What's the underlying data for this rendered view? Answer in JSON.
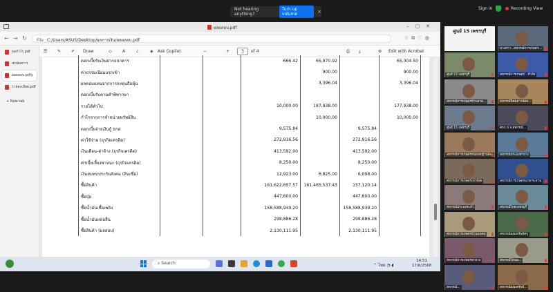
{
  "zoom": {
    "notice_text": "Not hearing anything?",
    "notice_button": "Turn up volume",
    "sign_in": "Sign in",
    "recording": "Recording",
    "view": "View"
  },
  "browser": {
    "window_title": "ผลผลอบ.pdf",
    "url_prefix": "File",
    "url": "C:/Users/ASUS/Desktop/ผลการเงิน/ผลผลอบ.pdf",
    "tabs": [
      {
        "label": "ผลกำไร.pdf"
      },
      {
        "label": "สรุปผลการเงิน.pdf"
      },
      {
        "label": "ผลผลอบ.pdf"
      },
      {
        "label": "รายละเอียด.pdf"
      }
    ],
    "new_tab": "New tab"
  },
  "pdf_toolbar": {
    "draw": "Draw",
    "ask_copilot": "Ask Copilot",
    "minus": "−",
    "plus": "+",
    "page_current": "3",
    "page_total": "of 4",
    "edit_acrobat": "Edit with Acrobat"
  },
  "table": {
    "rows": [
      [
        "ดอกเบี้ยรับเงินฝากธนาคาร",
        "",
        "",
        "666.42",
        "65,970.92",
        "",
        "65,304.50"
      ],
      [
        "ค่าธรรมเนียมแรกเข้า",
        "",
        "",
        "",
        "900.00",
        "",
        "900.00"
      ],
      [
        "ผลตอบแทนจากการลงทุนถือหุ้น",
        "",
        "",
        "",
        "3,396.04",
        "",
        "3,396.04"
      ],
      [
        "ดอกเบี้ยรับตามคำพิพากษา",
        "",
        "",
        "",
        "",
        "",
        ""
      ],
      [
        "รายได้ทั่วไป",
        "",
        "",
        "10,000.00",
        "187,938.00",
        "",
        "177,938.00"
      ],
      [
        "กำไรจากการจำหน่ายทรัพย์สิน",
        "",
        "",
        "",
        "10,000.00",
        "",
        "10,000.00"
      ],
      [
        "ดอกเบี้ยจ่ายเงินกู้ ธกส",
        "",
        "",
        "9,575.84",
        "",
        "9,575.84",
        ""
      ],
      [
        "ค่าใช้จ่าย (ธุรกิจเครดิต)",
        "",
        "",
        "272,916.56",
        "",
        "272,916.56",
        ""
      ],
      [
        "เงินเดือน-ค่าจ้าง (ธุรกิจเครดิต)",
        "",
        "",
        "413,592.00",
        "",
        "413,592.00",
        ""
      ],
      [
        "ค่าเบี้ยเลี้ยงพาหนะ (ธุรกิจเครดิต)",
        "",
        "",
        "8,250.00",
        "",
        "8,250.00",
        ""
      ],
      [
        "เงินสมทบประกันสังคม (สินเชื่อ)",
        "",
        "",
        "12,923.00",
        "6,825.00",
        "6,098.00",
        ""
      ],
      [
        "ซื้อสินค้า",
        "",
        "",
        "161,622,657.57",
        "161,465,537.43",
        "157,120.14",
        ""
      ],
      [
        "ซื้อปุ๋ย",
        "",
        "",
        "447,600.00",
        "",
        "447,600.00",
        ""
      ],
      [
        "ซื้อน้ำมันเชื้อเพลิง",
        "",
        "",
        "158,588,939.20",
        "",
        "158,588,939.20",
        ""
      ],
      [
        "ซื้อน้ำมันหล่อลื่น",
        "",
        "",
        "298,886.28",
        "",
        "298,886.28",
        ""
      ],
      [
        "ซื้อสินค้า (ผลสอบ)",
        "",
        "",
        "2,130,111.95",
        "",
        "2,130,111.95",
        ""
      ]
    ]
  },
  "taskbar": {
    "search": "Search",
    "lang": "ไทย",
    "time": "14:51",
    "date": "17/6/2568"
  },
  "participants": [
    {
      "name": "ศูนย์ 15 เพชรบุรี",
      "title": true
    },
    {
      "name": "นางสาว...สหกรณ์การเกษตร...",
      "title": false
    },
    {
      "name": "ศูนย์ 15 เพชรบุรี",
      "title": false
    },
    {
      "name": "สหกรณ์การเกษตร...จำกัด",
      "title": false
    },
    {
      "name": "สหกรณ์การเกษตรบ้านลาด...",
      "title": false
    },
    {
      "name": "สหกรณ์นิคมอ่าวน้อย...",
      "title": false
    },
    {
      "name": "ศูนย์ 15 เพชรบุรี",
      "title": false
    },
    {
      "name": "ศกก.ป จ.สหกรณ์...",
      "title": false
    },
    {
      "name": "สหกรณ์การเกษตรหนองหญ้าปล้อง",
      "title": false
    },
    {
      "name": "สหกรณ์ประมงท่ายาง",
      "title": false
    },
    {
      "name": "สหกรณ์การเกษตรเขาย้อย",
      "title": false
    },
    {
      "name": "สหกรณ์การเกษตรแก่งกระจาน",
      "title": false
    },
    {
      "name": "สหกรณ์ประมงชะอำ",
      "title": false
    },
    {
      "name": "สหกรณ์ไทยเพชรบุรี",
      "title": false
    },
    {
      "name": "สหกรณ์การเกษตรบ้านแหลม",
      "title": false
    },
    {
      "name": "สหกรณ์ออมทรัพย์ครู",
      "title": false
    },
    {
      "name": "สหกรณ์การเกษตรท่ายาง",
      "title": false
    },
    {
      "name": "สหกรณ์โคนม...",
      "title": false
    },
    {
      "name": "สหกรณ์...",
      "title": false
    },
    {
      "name": "สหกรณ์ออมทรัพย์...",
      "title": false
    }
  ]
}
